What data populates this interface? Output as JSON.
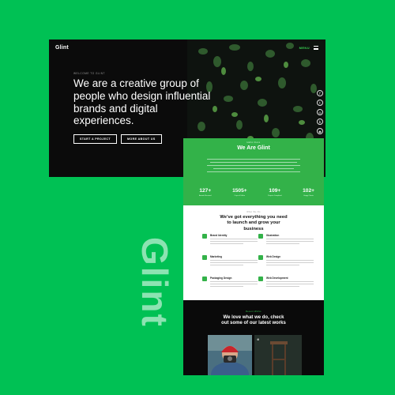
{
  "brand_word": "Glint",
  "colors": {
    "background": "#00c154",
    "accent": "#33b249",
    "dark": "#0b0b0b"
  },
  "hero": {
    "logo": "Glint",
    "menu_label": "MENU",
    "kicker": "WELCOME TO GLINT",
    "headline": "We are a creative group of people who design influential brands and digital experiences.",
    "buttons": [
      "START A PROJECT",
      "MORE ABOUT US"
    ],
    "social_icons": [
      "facebook-icon",
      "twitter-icon",
      "instagram-icon",
      "behance-icon",
      "dribbble-icon"
    ]
  },
  "about": {
    "kicker": "Hello there",
    "title": "We Are Glint",
    "stats": [
      {
        "value": "127+",
        "label": "Awards Received"
      },
      {
        "value": "1505+",
        "label": "Cups of Coffee"
      },
      {
        "value": "109+",
        "label": "Projects Completed"
      },
      {
        "value": "102+",
        "label": "Happy Clients"
      }
    ]
  },
  "services": {
    "kicker": "What We Do",
    "heading": "We’ve got everything you need to launch and grow your business",
    "items": [
      {
        "name": "Brand Identity"
      },
      {
        "name": "Illustration"
      },
      {
        "name": "Marketing"
      },
      {
        "name": "Web Design"
      },
      {
        "name": "Packaging Design"
      },
      {
        "name": "Web Development"
      }
    ]
  },
  "works": {
    "kicker": "Recent Works",
    "heading": "We love what we do, check out some of our latest works"
  }
}
